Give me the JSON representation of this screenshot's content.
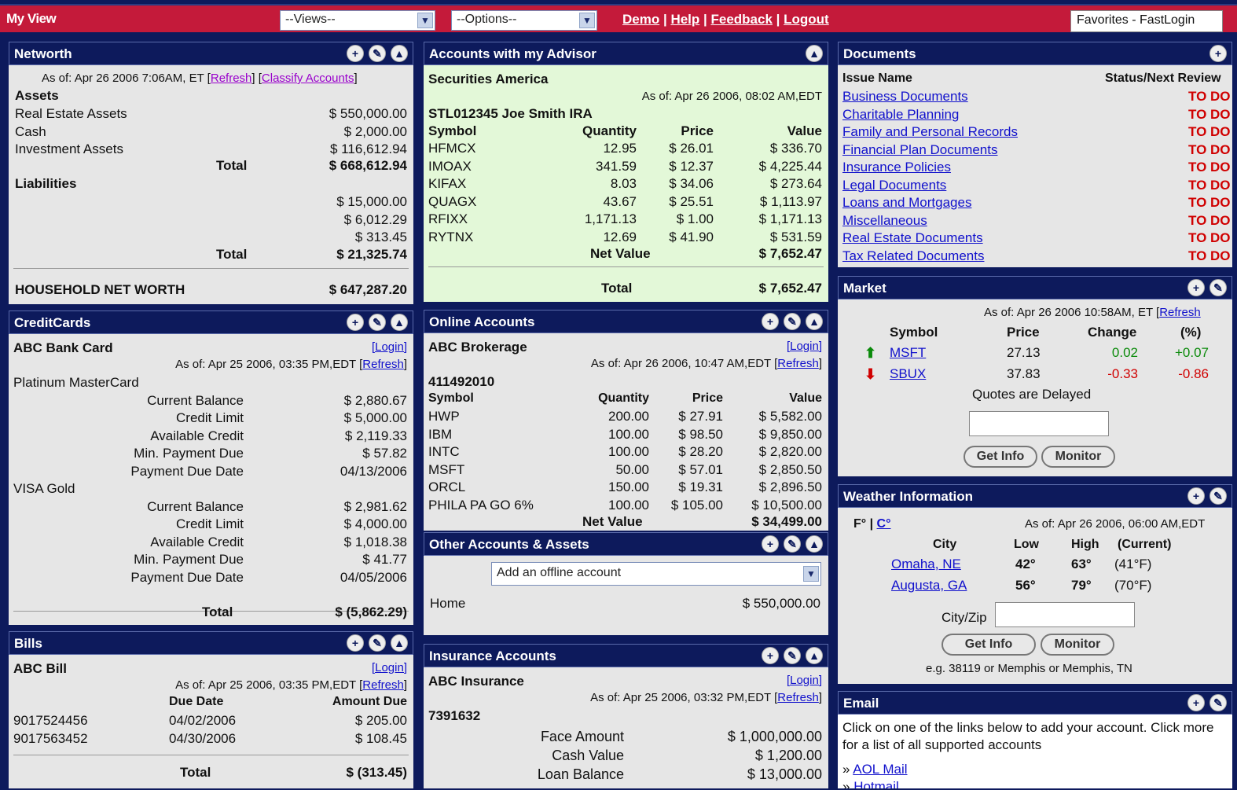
{
  "top": {
    "title": "My View",
    "views": "--Views--",
    "options": "--Options--",
    "demo": "Demo",
    "help": "Help",
    "feedback": "Feedback",
    "logout": "Logout",
    "favorites": "Favorites - FastLogin"
  },
  "networth": {
    "title": "Networth",
    "asof": "As of: Apr 26 2006 7:06AM, ET [",
    "refresh": "Refresh",
    "classify": "Classify Accounts",
    "assets": "Assets",
    "liabilities": "Liabilities",
    "total": "Total",
    "asset_rows": [
      {
        "label": "Real Estate Assets",
        "value": "$ 550,000.00"
      },
      {
        "label": "Cash",
        "value": "$ 2,000.00"
      },
      {
        "label": "Investment Assets",
        "value": "$ 116,612.94"
      }
    ],
    "asset_total": "$ 668,612.94",
    "liab_rows": [
      "$ 15,000.00",
      "$ 6,012.29",
      "$ 313.45"
    ],
    "liab_total": "$ 21,325.74",
    "hnw_label": "HOUSEHOLD NET WORTH",
    "hnw": "$ 647,287.20"
  },
  "advisor": {
    "title": "Accounts with my Advisor",
    "firm": "Securities America",
    "asof": "As of: Apr 26 2006, 08:02 AM,EDT",
    "account": "STL012345 Joe Smith IRA",
    "headers": [
      "Symbol",
      "Quantity",
      "Price",
      "Value"
    ],
    "rows": [
      [
        "HFMCX",
        "12.95",
        "$ 26.01",
        "$ 336.70"
      ],
      [
        "IMOAX",
        "341.59",
        "$ 12.37",
        "$ 4,225.44"
      ],
      [
        "KIFAX",
        "8.03",
        "$ 34.06",
        "$ 273.64"
      ],
      [
        "QUAGX",
        "43.67",
        "$ 25.51",
        "$ 1,113.97"
      ],
      [
        "RFIXX",
        "1,171.13",
        "$ 1.00",
        "$ 1,171.13"
      ],
      [
        "RYTNX",
        "12.69",
        "$ 41.90",
        "$ 531.59"
      ]
    ],
    "net_label": "Net Value",
    "net": "$ 7,652.47",
    "total_label": "Total",
    "total": "$ 7,652.47"
  },
  "documents": {
    "title": "Documents",
    "col1": "Issue Name",
    "col2": "Status/Next Review",
    "items": [
      "Business Documents",
      "Charitable Planning",
      "Family and Personal Records",
      "Financial Plan Documents",
      "Insurance Policies",
      "Legal Documents",
      "Loans and Mortgages",
      "Miscellaneous",
      "Real Estate Documents",
      "Tax Related Documents"
    ],
    "status": "TO DO"
  },
  "credit": {
    "title": "CreditCards",
    "bank": "ABC Bank Card",
    "login": "[Login]",
    "asof": "As of: Apr 25 2006, 03:35 PM,EDT [",
    "refresh": "Refresh",
    "cards": [
      {
        "name": "Platinum MasterCard",
        "rows": [
          [
            "Current Balance",
            "$ 2,880.67"
          ],
          [
            "Credit Limit",
            "$ 5,000.00"
          ],
          [
            "Available Credit",
            "$ 2,119.33"
          ],
          [
            "Min. Payment Due",
            "$ 57.82"
          ],
          [
            "Payment Due Date",
            "04/13/2006"
          ]
        ]
      },
      {
        "name": "VISA Gold",
        "rows": [
          [
            "Current Balance",
            "$ 2,981.62"
          ],
          [
            "Credit Limit",
            "$ 4,000.00"
          ],
          [
            "Available Credit",
            "$ 1,018.38"
          ],
          [
            "Min. Payment Due",
            "$ 41.77"
          ],
          [
            "Payment Due Date",
            "04/05/2006"
          ]
        ]
      }
    ],
    "total_label": "Total",
    "total": "$ (5,862.29)"
  },
  "online": {
    "title": "Online Accounts",
    "firm": "ABC Brokerage",
    "login": "[Login]",
    "asof": "As of: Apr 26 2006, 10:47 AM,EDT [",
    "refresh": "Refresh",
    "account": "411492010",
    "headers": [
      "Symbol",
      "Quantity",
      "Price",
      "Value"
    ],
    "rows": [
      [
        "HWP",
        "200.00",
        "$ 27.91",
        "$ 5,582.00"
      ],
      [
        "IBM",
        "100.00",
        "$ 98.50",
        "$ 9,850.00"
      ],
      [
        "INTC",
        "100.00",
        "$ 28.20",
        "$ 2,820.00"
      ],
      [
        "MSFT",
        "50.00",
        "$ 57.01",
        "$ 2,850.50"
      ],
      [
        "ORCL",
        "150.00",
        "$ 19.31",
        "$ 2,896.50"
      ],
      [
        "PHILA PA GO 6%",
        "100.00",
        "$ 105.00",
        "$ 10,500.00"
      ]
    ],
    "net_label": "Net Value",
    "net": "$ 34,499.00"
  },
  "market": {
    "title": "Market",
    "asof": "As of: Apr 26 2006 10:58AM, ET [",
    "refresh": "Refresh",
    "headers": [
      "Symbol",
      "Price",
      "Change",
      "(%)"
    ],
    "rows": [
      {
        "sym": "MSFT",
        "price": "27.13",
        "change": "0.02",
        "pct": "+0.07",
        "dir": "up"
      },
      {
        "sym": "SBUX",
        "price": "37.83",
        "change": "-0.33",
        "pct": "-0.86",
        "dir": "down"
      }
    ],
    "delayed": "Quotes are Delayed",
    "getinfo": "Get Info",
    "monitor": "Monitor"
  },
  "other": {
    "title": "Other Accounts & Assets",
    "select": "Add an offline account",
    "home": "Home",
    "home_value": "$ 550,000.00"
  },
  "weather": {
    "title": "Weather Information",
    "f": "F°",
    "c": "C°",
    "asof": "As of: Apr 26 2006, 06:00 AM,EDT",
    "headers": [
      "City",
      "Low",
      "High",
      "(Current)"
    ],
    "rows": [
      [
        "Omaha, NE",
        "42°",
        "63°",
        "(41°F)"
      ],
      [
        "Augusta, GA",
        "56°",
        "79°",
        "(70°F)"
      ]
    ],
    "cityzip": "City/Zip",
    "getinfo": "Get Info",
    "monitor": "Monitor",
    "example": "e.g. 38119 or Memphis or Memphis, TN"
  },
  "bills": {
    "title": "Bills",
    "name": "ABC Bill",
    "login": "[Login]",
    "asof": "As of: Apr 25 2006, 03:35 PM,EDT [",
    "refresh": "Refresh",
    "headers": [
      "Due Date",
      "Amount Due"
    ],
    "rows": [
      [
        "9017524456",
        "04/02/2006",
        "$ 205.00"
      ],
      [
        "9017563452",
        "04/30/2006",
        "$ 108.45"
      ]
    ],
    "total_label": "Total",
    "total": "$ (313.45)"
  },
  "insurance": {
    "title": "Insurance Accounts",
    "firm": "ABC Insurance",
    "login": "[Login]",
    "asof": "As of: Apr 25 2006, 03:32 PM,EDT [",
    "refresh": "Refresh",
    "account": "7391632",
    "rows": [
      [
        "Face Amount",
        "$ 1,000,000.00"
      ],
      [
        "Cash Value",
        "$ 1,200.00"
      ],
      [
        "Loan Balance",
        "$ 13,000.00"
      ]
    ]
  },
  "email": {
    "title": "Email",
    "text": "Click on one of the links below to add your account. Click more for a list of all supported accounts",
    "links": [
      "AOL Mail",
      "Hotmail"
    ]
  }
}
